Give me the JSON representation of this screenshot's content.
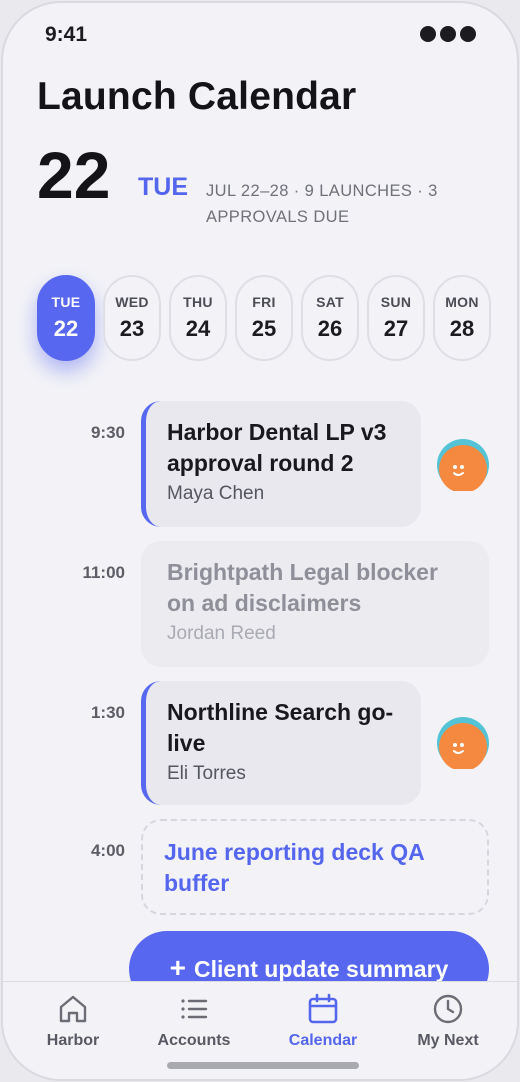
{
  "status_bar": {
    "time": "9:41"
  },
  "header": {
    "title": "Launch Calendar",
    "day_number": "22",
    "day_name": "TUE",
    "week_summary": "JUL 22–28 · 9 LAUNCHES · 3 APPROVALS DUE"
  },
  "date_strip": [
    {
      "dow": "TUE",
      "num": "22",
      "active": true
    },
    {
      "dow": "WED",
      "num": "23"
    },
    {
      "dow": "THU",
      "num": "24"
    },
    {
      "dow": "FRI",
      "num": "25"
    },
    {
      "dow": "SAT",
      "num": "26"
    },
    {
      "dow": "SUN",
      "num": "27"
    },
    {
      "dow": "MON",
      "num": "28"
    }
  ],
  "events": [
    {
      "time": "9:30",
      "title": "Harbor Dental LP v3 approval round 2",
      "owner": "Maya Chen",
      "style": "accent",
      "avatar": "avatar-icon"
    },
    {
      "time": "11:00",
      "title": "Brightpath Legal blocker on ad disclaimers",
      "owner": "Jordan Reed",
      "style": "muted"
    },
    {
      "time": "1:30",
      "title": "Northline Search go-live",
      "owner": "Eli Torres",
      "style": "accent",
      "avatar": "avatar-icon"
    },
    {
      "time": "4:00",
      "title": "June reporting deck QA buffer",
      "style": "dashed"
    }
  ],
  "fab": {
    "label": "Client update summary",
    "icon": "plus-icon"
  },
  "tabs": [
    {
      "label": "Harbor",
      "icon": "home-icon"
    },
    {
      "label": "Accounts",
      "icon": "list-icon"
    },
    {
      "label": "Calendar",
      "icon": "calendar-icon",
      "active": true
    },
    {
      "label": "My Next",
      "icon": "clock-icon"
    }
  ],
  "colors": {
    "accent": "#5867f0",
    "avatar_bg": "#f5893f",
    "avatar_ring": "#55c3d6"
  }
}
